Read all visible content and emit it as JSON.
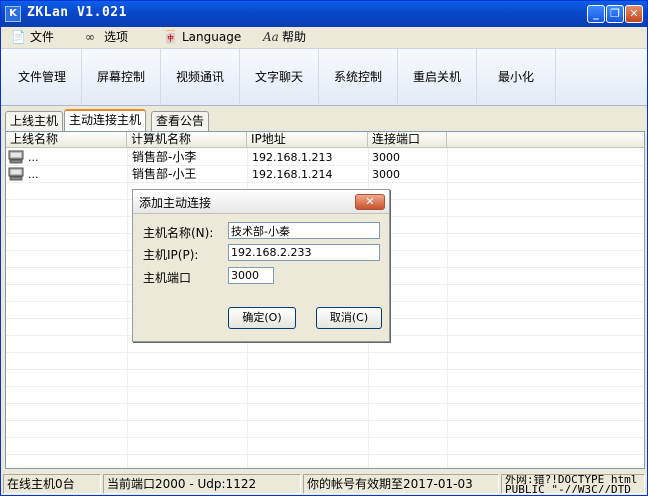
{
  "window": {
    "title": "ZKLan V1.021"
  },
  "menu": [
    {
      "label": "文件",
      "icon": "file-icon"
    },
    {
      "label": "选项",
      "icon": "glasses-icon"
    },
    {
      "label": "Language",
      "icon": "language-icon"
    },
    {
      "label": "帮助",
      "icon": "help-icon"
    }
  ],
  "toolbar": [
    "文件管理",
    "屏幕控制",
    "视频通讯",
    "文字聊天",
    "系统控制",
    "重启关机",
    "最小化"
  ],
  "tabs": [
    "上线主机",
    "主动连接主机",
    "查看公告"
  ],
  "list": {
    "columns": [
      "上线名称",
      "计算机名称",
      "IP地址",
      "连接端口"
    ],
    "rows": [
      {
        "name": "...",
        "computer": "销售部-小李",
        "ip": "192.168.1.213",
        "port": "3000"
      },
      {
        "name": "...",
        "computer": "销售部-小王",
        "ip": "192.168.1.214",
        "port": "3000"
      }
    ]
  },
  "dialog": {
    "title": "添加主动连接",
    "host_name_label": "主机名称(N):",
    "host_name_value": "技术部-小秦",
    "host_ip_label": "主机IP(P):",
    "host_ip_value": "192.168.2.233",
    "host_port_label": "主机端口",
    "host_port_value": "3000",
    "ok_label": "确定(O)",
    "cancel_label": "取消(C)"
  },
  "status": {
    "online": "在线主机0台",
    "port": "当前端口2000 - Udp:1122",
    "expiry": "你的帐号有效期至2017-01-03",
    "ticker": "外网:错?!DOCTYPE html PUBLIC \"-//W3C//DTD"
  }
}
